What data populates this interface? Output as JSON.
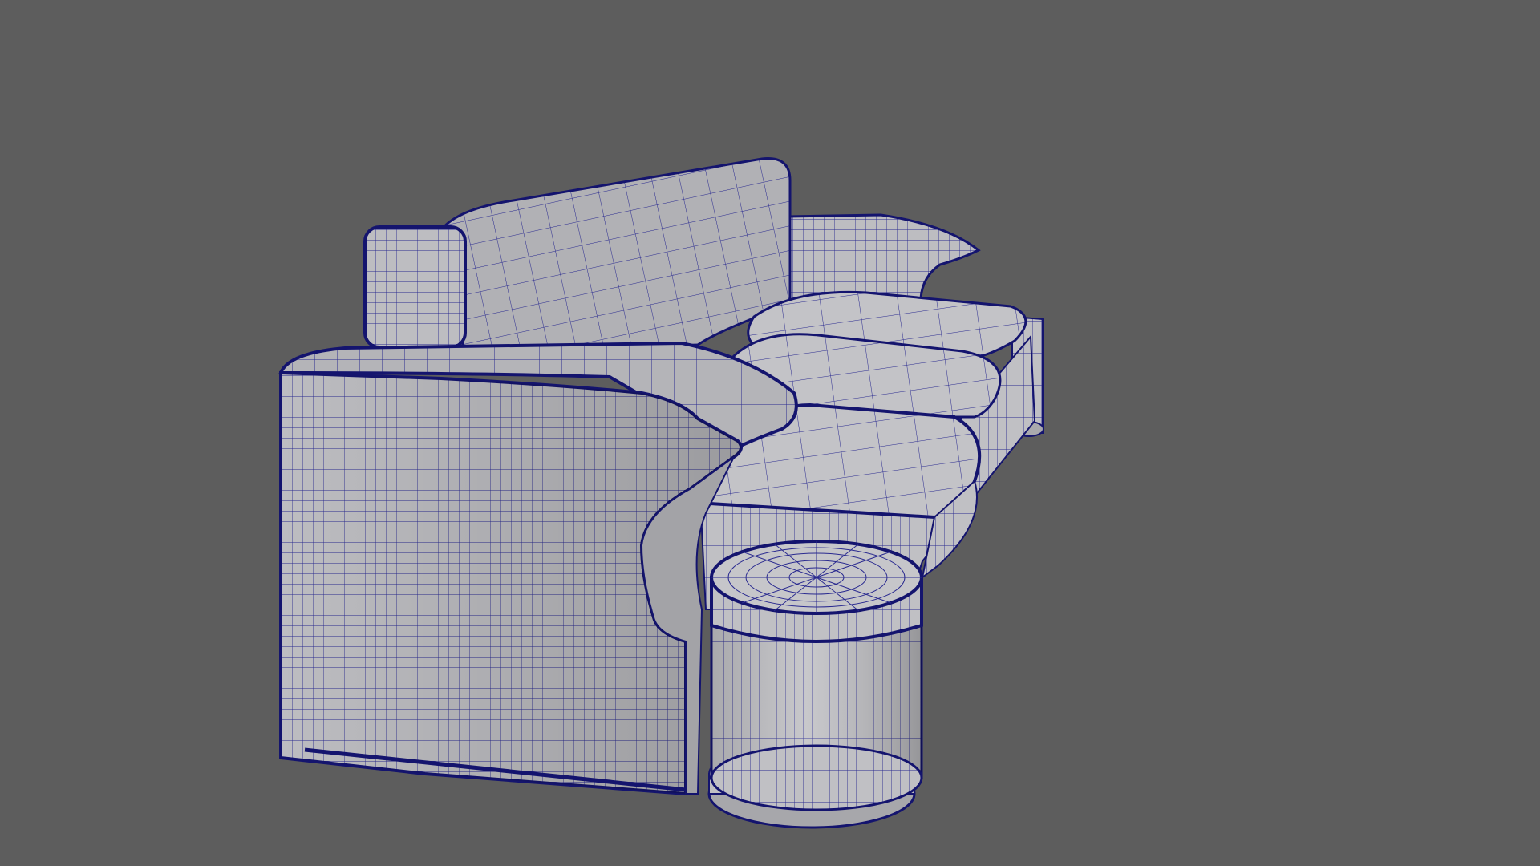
{
  "viewport": {
    "background_color": "#5d5d5d",
    "display_mode": "wireframe-on-shaded",
    "wireframe_color": "#1f1f8a",
    "surface_color": "#b9b9bd"
  },
  "scene": {
    "model": "sofa",
    "parts": [
      "backrest",
      "back-left-cap",
      "right-arm",
      "left-arm",
      "seat-cushions",
      "side-table-cylinder",
      "right-foot"
    ]
  }
}
